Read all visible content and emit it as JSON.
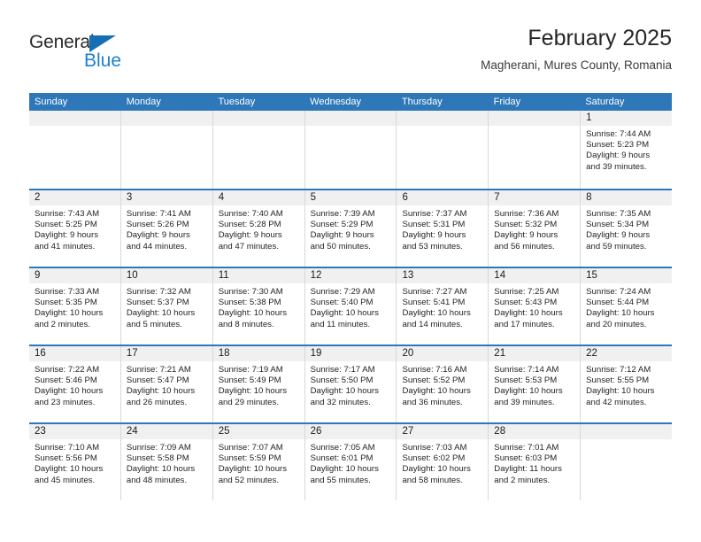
{
  "brand": {
    "name_part1": "General",
    "name_part2": "Blue"
  },
  "header": {
    "title": "February 2025",
    "subtitle": "Magherani, Mures County, Romania"
  },
  "colors": {
    "header_blue": "#2e77b8",
    "brand_blue": "#1b7fd4",
    "daynum_band": "#f0f0f0",
    "cell_border": "#d8d8d8"
  },
  "weekdays": [
    "Sunday",
    "Monday",
    "Tuesday",
    "Wednesday",
    "Thursday",
    "Friday",
    "Saturday"
  ],
  "weeks": [
    [
      {
        "day": "",
        "sunrise": "",
        "sunset": "",
        "daylight1": "",
        "daylight2": "",
        "empty": true
      },
      {
        "day": "",
        "sunrise": "",
        "sunset": "",
        "daylight1": "",
        "daylight2": "",
        "empty": true
      },
      {
        "day": "",
        "sunrise": "",
        "sunset": "",
        "daylight1": "",
        "daylight2": "",
        "empty": true
      },
      {
        "day": "",
        "sunrise": "",
        "sunset": "",
        "daylight1": "",
        "daylight2": "",
        "empty": true
      },
      {
        "day": "",
        "sunrise": "",
        "sunset": "",
        "daylight1": "",
        "daylight2": "",
        "empty": true
      },
      {
        "day": "",
        "sunrise": "",
        "sunset": "",
        "daylight1": "",
        "daylight2": "",
        "empty": true
      },
      {
        "day": "1",
        "sunrise": "Sunrise: 7:44 AM",
        "sunset": "Sunset: 5:23 PM",
        "daylight1": "Daylight: 9 hours",
        "daylight2": "and 39 minutes."
      }
    ],
    [
      {
        "day": "2",
        "sunrise": "Sunrise: 7:43 AM",
        "sunset": "Sunset: 5:25 PM",
        "daylight1": "Daylight: 9 hours",
        "daylight2": "and 41 minutes."
      },
      {
        "day": "3",
        "sunrise": "Sunrise: 7:41 AM",
        "sunset": "Sunset: 5:26 PM",
        "daylight1": "Daylight: 9 hours",
        "daylight2": "and 44 minutes."
      },
      {
        "day": "4",
        "sunrise": "Sunrise: 7:40 AM",
        "sunset": "Sunset: 5:28 PM",
        "daylight1": "Daylight: 9 hours",
        "daylight2": "and 47 minutes."
      },
      {
        "day": "5",
        "sunrise": "Sunrise: 7:39 AM",
        "sunset": "Sunset: 5:29 PM",
        "daylight1": "Daylight: 9 hours",
        "daylight2": "and 50 minutes."
      },
      {
        "day": "6",
        "sunrise": "Sunrise: 7:37 AM",
        "sunset": "Sunset: 5:31 PM",
        "daylight1": "Daylight: 9 hours",
        "daylight2": "and 53 minutes."
      },
      {
        "day": "7",
        "sunrise": "Sunrise: 7:36 AM",
        "sunset": "Sunset: 5:32 PM",
        "daylight1": "Daylight: 9 hours",
        "daylight2": "and 56 minutes."
      },
      {
        "day": "8",
        "sunrise": "Sunrise: 7:35 AM",
        "sunset": "Sunset: 5:34 PM",
        "daylight1": "Daylight: 9 hours",
        "daylight2": "and 59 minutes."
      }
    ],
    [
      {
        "day": "9",
        "sunrise": "Sunrise: 7:33 AM",
        "sunset": "Sunset: 5:35 PM",
        "daylight1": "Daylight: 10 hours",
        "daylight2": "and 2 minutes."
      },
      {
        "day": "10",
        "sunrise": "Sunrise: 7:32 AM",
        "sunset": "Sunset: 5:37 PM",
        "daylight1": "Daylight: 10 hours",
        "daylight2": "and 5 minutes."
      },
      {
        "day": "11",
        "sunrise": "Sunrise: 7:30 AM",
        "sunset": "Sunset: 5:38 PM",
        "daylight1": "Daylight: 10 hours",
        "daylight2": "and 8 minutes."
      },
      {
        "day": "12",
        "sunrise": "Sunrise: 7:29 AM",
        "sunset": "Sunset: 5:40 PM",
        "daylight1": "Daylight: 10 hours",
        "daylight2": "and 11 minutes."
      },
      {
        "day": "13",
        "sunrise": "Sunrise: 7:27 AM",
        "sunset": "Sunset: 5:41 PM",
        "daylight1": "Daylight: 10 hours",
        "daylight2": "and 14 minutes."
      },
      {
        "day": "14",
        "sunrise": "Sunrise: 7:25 AM",
        "sunset": "Sunset: 5:43 PM",
        "daylight1": "Daylight: 10 hours",
        "daylight2": "and 17 minutes."
      },
      {
        "day": "15",
        "sunrise": "Sunrise: 7:24 AM",
        "sunset": "Sunset: 5:44 PM",
        "daylight1": "Daylight: 10 hours",
        "daylight2": "and 20 minutes."
      }
    ],
    [
      {
        "day": "16",
        "sunrise": "Sunrise: 7:22 AM",
        "sunset": "Sunset: 5:46 PM",
        "daylight1": "Daylight: 10 hours",
        "daylight2": "and 23 minutes."
      },
      {
        "day": "17",
        "sunrise": "Sunrise: 7:21 AM",
        "sunset": "Sunset: 5:47 PM",
        "daylight1": "Daylight: 10 hours",
        "daylight2": "and 26 minutes."
      },
      {
        "day": "18",
        "sunrise": "Sunrise: 7:19 AM",
        "sunset": "Sunset: 5:49 PM",
        "daylight1": "Daylight: 10 hours",
        "daylight2": "and 29 minutes."
      },
      {
        "day": "19",
        "sunrise": "Sunrise: 7:17 AM",
        "sunset": "Sunset: 5:50 PM",
        "daylight1": "Daylight: 10 hours",
        "daylight2": "and 32 minutes."
      },
      {
        "day": "20",
        "sunrise": "Sunrise: 7:16 AM",
        "sunset": "Sunset: 5:52 PM",
        "daylight1": "Daylight: 10 hours",
        "daylight2": "and 36 minutes."
      },
      {
        "day": "21",
        "sunrise": "Sunrise: 7:14 AM",
        "sunset": "Sunset: 5:53 PM",
        "daylight1": "Daylight: 10 hours",
        "daylight2": "and 39 minutes."
      },
      {
        "day": "22",
        "sunrise": "Sunrise: 7:12 AM",
        "sunset": "Sunset: 5:55 PM",
        "daylight1": "Daylight: 10 hours",
        "daylight2": "and 42 minutes."
      }
    ],
    [
      {
        "day": "23",
        "sunrise": "Sunrise: 7:10 AM",
        "sunset": "Sunset: 5:56 PM",
        "daylight1": "Daylight: 10 hours",
        "daylight2": "and 45 minutes."
      },
      {
        "day": "24",
        "sunrise": "Sunrise: 7:09 AM",
        "sunset": "Sunset: 5:58 PM",
        "daylight1": "Daylight: 10 hours",
        "daylight2": "and 48 minutes."
      },
      {
        "day": "25",
        "sunrise": "Sunrise: 7:07 AM",
        "sunset": "Sunset: 5:59 PM",
        "daylight1": "Daylight: 10 hours",
        "daylight2": "and 52 minutes."
      },
      {
        "day": "26",
        "sunrise": "Sunrise: 7:05 AM",
        "sunset": "Sunset: 6:01 PM",
        "daylight1": "Daylight: 10 hours",
        "daylight2": "and 55 minutes."
      },
      {
        "day": "27",
        "sunrise": "Sunrise: 7:03 AM",
        "sunset": "Sunset: 6:02 PM",
        "daylight1": "Daylight: 10 hours",
        "daylight2": "and 58 minutes."
      },
      {
        "day": "28",
        "sunrise": "Sunrise: 7:01 AM",
        "sunset": "Sunset: 6:03 PM",
        "daylight1": "Daylight: 11 hours",
        "daylight2": "and 2 minutes."
      },
      {
        "day": "",
        "sunrise": "",
        "sunset": "",
        "daylight1": "",
        "daylight2": "",
        "empty": true
      }
    ]
  ]
}
